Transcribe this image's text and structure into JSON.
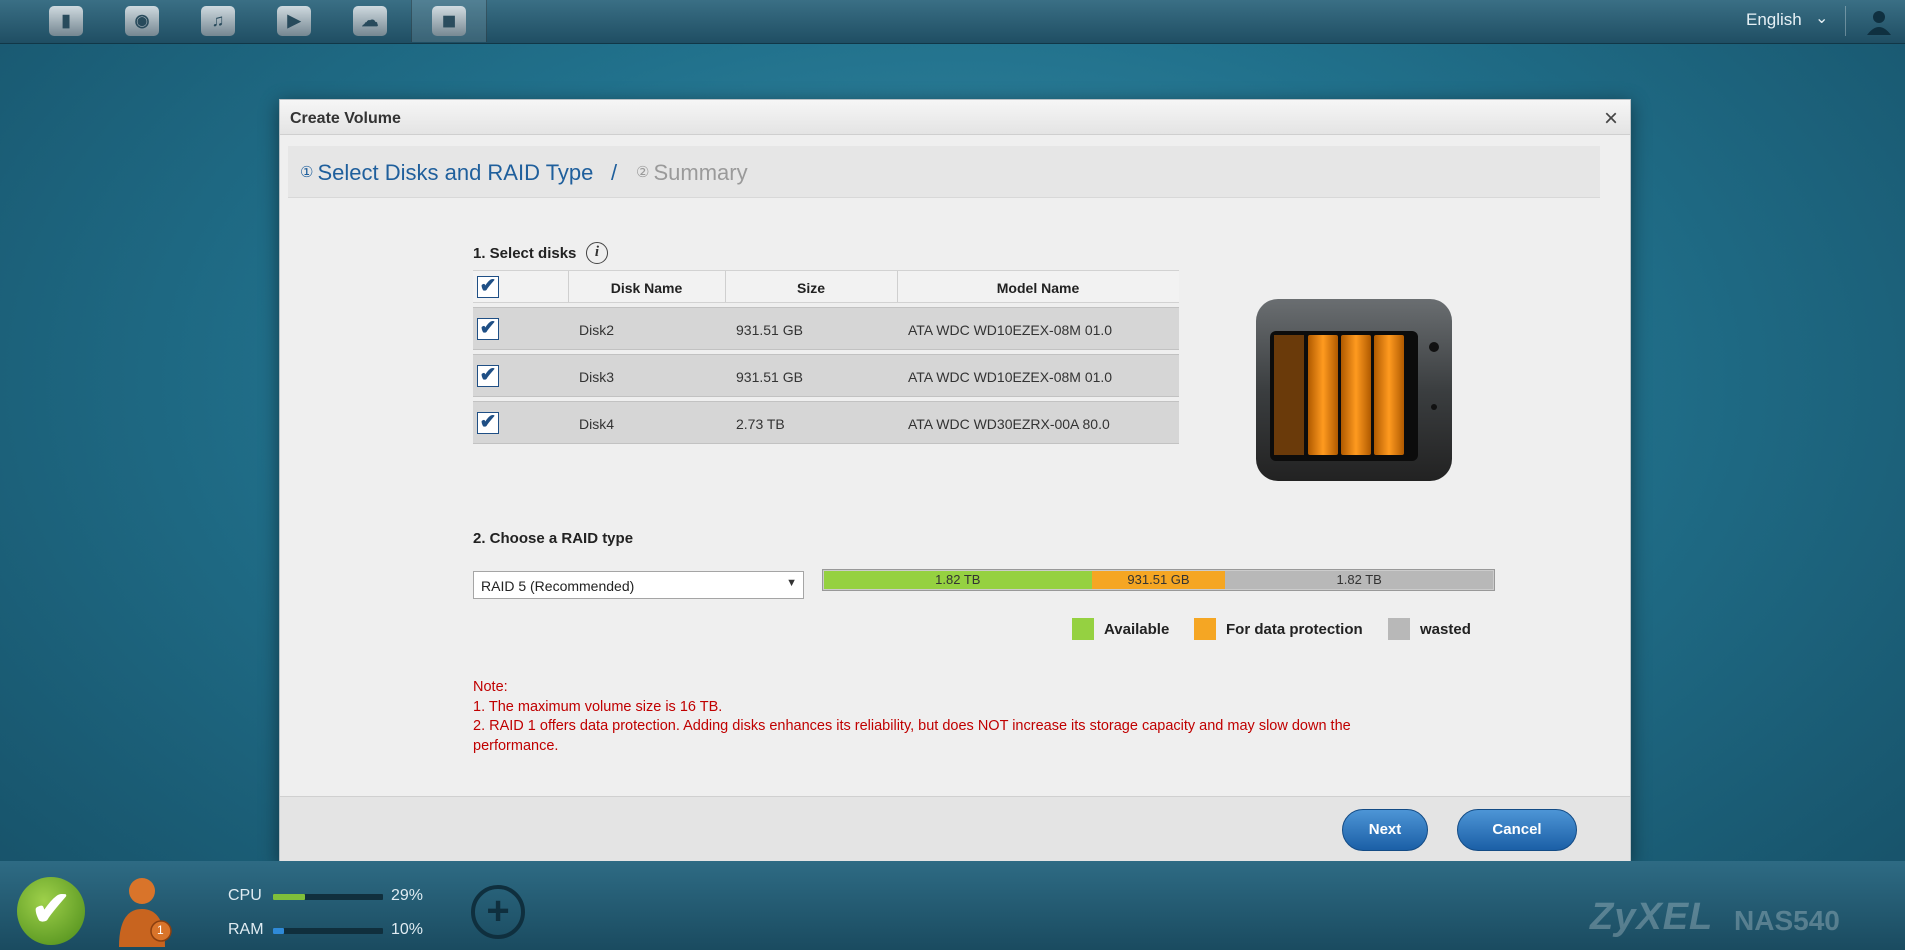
{
  "topbar": {
    "apps": [
      {
        "icon": "document-app-icon",
        "glyph": "▮"
      },
      {
        "icon": "camera-app-icon",
        "glyph": "◉"
      },
      {
        "icon": "music-app-icon",
        "glyph": "♫"
      },
      {
        "icon": "video-app-icon",
        "glyph": "▶"
      },
      {
        "icon": "zyxel-cloud-icon",
        "glyph": "☁"
      },
      {
        "icon": "storage-manager-icon",
        "glyph": "◼"
      }
    ],
    "language": "English"
  },
  "modal": {
    "title": "Create Volume",
    "close": "×",
    "step1_num": "①",
    "step1": "Select Disks and RAID Type",
    "step_sep": "/",
    "step2_num": "②",
    "step2": "Summary",
    "select_disks_title": "1. Select disks",
    "info_glyph": "i",
    "table": {
      "headers": [
        "Disk Name",
        "Size",
        "Model Name"
      ],
      "rows": [
        {
          "name": "Disk2",
          "size": "931.51 GB",
          "model": "ATA WDC WD10EZEX-08M 01.0"
        },
        {
          "name": "Disk3",
          "size": "931.51 GB",
          "model": "ATA WDC WD10EZEX-08M 01.0"
        },
        {
          "name": "Disk4",
          "size": "2.73 TB",
          "model": "ATA WDC WD30EZRX-00A 80.0"
        }
      ],
      "check_glyph": "✔"
    },
    "raid_title": "2. Choose a RAID type",
    "raid_selected": "RAID 5  (Recommended)",
    "raid_arrow": "▼",
    "capacity_bar": {
      "available": "1.82 TB",
      "protection": "931.51 GB",
      "wasted": "1.82 TB",
      "available_fraction": 0.4,
      "protection_fraction": 0.2,
      "wasted_fraction": 0.4
    },
    "legend": {
      "available": "Available",
      "protection": "For data protection",
      "wasted": "wasted"
    },
    "colors": {
      "available": "#95d141",
      "protection": "#f5a623",
      "wasted": "#b8b8b8",
      "accent": "#1f5f9c",
      "note": "#c00000"
    },
    "note": {
      "heading": "Note:",
      "line1": "1. The maximum volume size is 16 TB.",
      "line2": "2. RAID 1 offers data protection. Adding disks enhances its reliability, but does NOT increase its storage capacity and may slow down the performance."
    },
    "next_label": "Next",
    "cancel_label": "Cancel"
  },
  "bottombar": {
    "ok_glyph": "✔",
    "notify_count": "1",
    "cpu_label": "CPU",
    "cpu_pct": "29%",
    "cpu_value": 0.29,
    "ram_label": "RAM",
    "ram_pct": "10%",
    "ram_value": 0.1,
    "plus_glyph": "+",
    "brand": "ZyXEL",
    "model": "NAS540"
  }
}
